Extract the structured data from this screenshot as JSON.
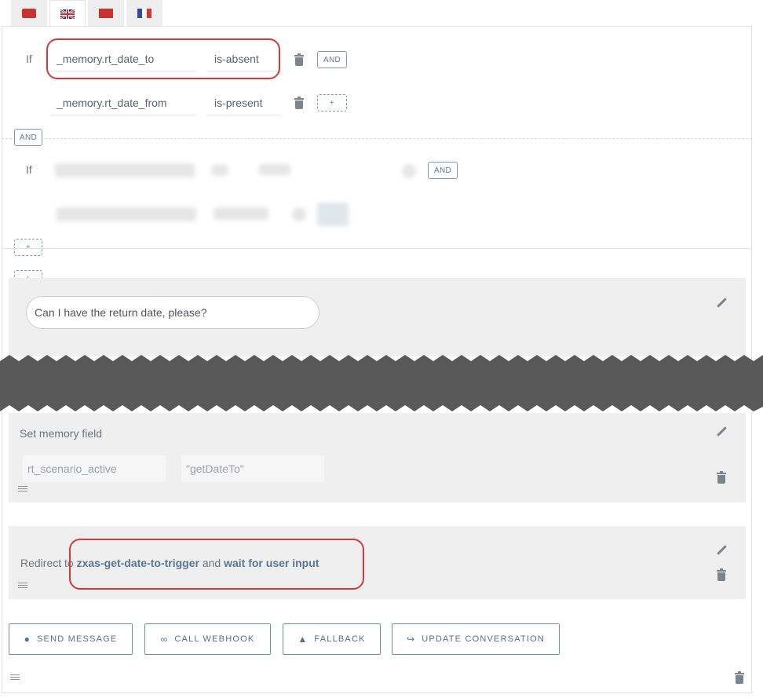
{
  "tabs": [
    {
      "name": "flag-1",
      "colors": [
        "#c9332f",
        "#c9332f"
      ]
    },
    {
      "name": "flag-uk",
      "colors": [
        "#1f3a7a",
        "#c9332f"
      ]
    },
    {
      "name": "flag-3",
      "colors": [
        "#c9332f",
        "#c9332f"
      ]
    },
    {
      "name": "flag-fr",
      "colors": [
        "#2b4aa0",
        "#d33"
      ]
    }
  ],
  "condition_group_1": {
    "if_label": "If",
    "rows": [
      {
        "field": "_memory.rt_date_to",
        "operator": "is-absent",
        "chip": "AND"
      },
      {
        "field": "_memory.rt_date_from",
        "operator": "is-present",
        "chip": "+"
      }
    ]
  },
  "group_connector": "AND",
  "condition_group_2": {
    "if_label": "If",
    "chip": "AND"
  },
  "add_condition": "+",
  "add_group": "+",
  "message": {
    "text": "Can I have the return date, please?"
  },
  "set_memory": {
    "title": "Set memory field",
    "key": "rt_scenario_active",
    "value": "\"getDateTo\""
  },
  "redirect": {
    "prefix": "Redirect to",
    "target": "zxas-get-date-to-trigger",
    "and": "and",
    "wait": "wait for user input"
  },
  "buttons": {
    "send_message": "SEND MESSAGE",
    "call_webhook": "CALL WEBHOOK",
    "fallback": "FALLBACK",
    "update_conversation": "UPDATE CONVERSATION"
  },
  "colors": {
    "highlight": "#d93838",
    "accent": "#55718a",
    "card_bg": "#efefef"
  }
}
